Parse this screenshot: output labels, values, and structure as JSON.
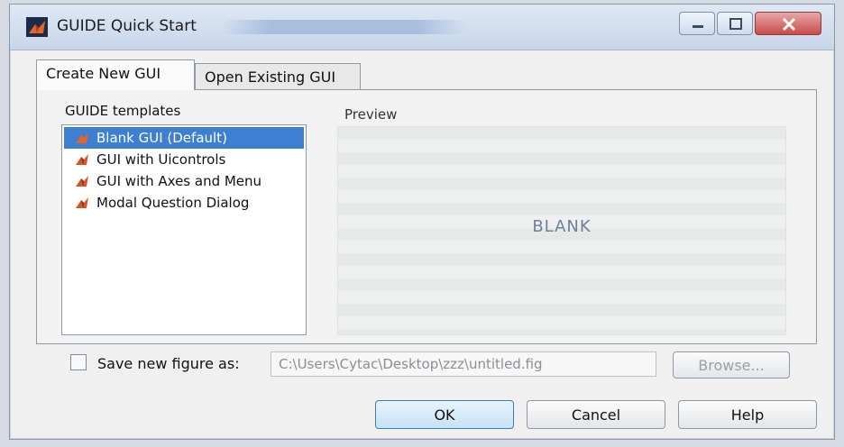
{
  "window": {
    "title": "GUIDE Quick Start",
    "controls": [
      "minimize-icon",
      "maximize-icon",
      "close-icon"
    ]
  },
  "tabs": [
    {
      "label": "Create New GUI",
      "active": true
    },
    {
      "label": "Open Existing GUI",
      "active": false
    }
  ],
  "templates": {
    "heading": "GUIDE templates",
    "items": [
      {
        "label": "Blank GUI (Default)",
        "selected": true,
        "icon": "matlab-icon"
      },
      {
        "label": "GUI with Uicontrols",
        "selected": false,
        "icon": "matlab-icon"
      },
      {
        "label": "GUI with Axes and Menu",
        "selected": false,
        "icon": "matlab-icon"
      },
      {
        "label": "Modal Question Dialog",
        "selected": false,
        "icon": "matlab-icon"
      }
    ]
  },
  "preview": {
    "heading": "Preview",
    "content_text": "BLANK"
  },
  "save": {
    "checkbox_label": "Save new figure as:",
    "checked": false,
    "path_value": "C:\\Users\\Cytac\\Desktop\\zzz\\untitled.fig",
    "browse_label": "Browse..."
  },
  "buttons": {
    "ok": "OK",
    "cancel": "Cancel",
    "help": "Help"
  },
  "colors": {
    "selection": "#3d7fd1",
    "close_button": "#c94a4a"
  }
}
